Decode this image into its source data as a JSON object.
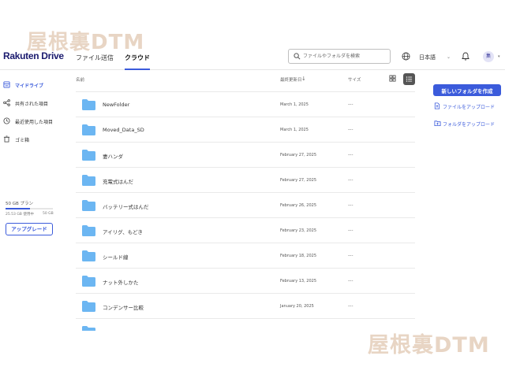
{
  "watermark": {
    "text": "屋根裏DTM"
  },
  "header": {
    "logo": "Rakuten Drive",
    "tabs": [
      {
        "label": "ファイル送信"
      },
      {
        "label": "クラウド"
      }
    ],
    "search_placeholder": "ファイルやフォルダを検索",
    "language": "日本語",
    "avatar_initial": "集"
  },
  "sidebar": {
    "items": [
      {
        "label": "マイドライブ",
        "icon": "my-drive-icon"
      },
      {
        "label": "共有された項目",
        "icon": "share-icon"
      },
      {
        "label": "最近使用した項目",
        "icon": "clock-icon"
      },
      {
        "label": "ゴミ箱",
        "icon": "trash-icon"
      }
    ],
    "storage": {
      "plan": "50 GB プラン",
      "used": "25.53 GB 使用中",
      "total": "50 GB",
      "used_fraction": 0.51
    },
    "upgrade_label": "アップグレード"
  },
  "table": {
    "columns": {
      "name": "名前",
      "date": "最終更新日",
      "size": "サイズ"
    },
    "rows": [
      {
        "name": "NewFolder",
        "date": "March 1, 2025",
        "size": "---"
      },
      {
        "name": "Moved_Data_SD",
        "date": "March 1, 2025",
        "size": "---"
      },
      {
        "name": "妻ハンダ",
        "date": "February 27, 2025",
        "size": "---"
      },
      {
        "name": "充電式はんだ",
        "date": "February 27, 2025",
        "size": "---"
      },
      {
        "name": "バッテリー式はんだ",
        "date": "February 26, 2025",
        "size": "---"
      },
      {
        "name": "アイリグ、もどき",
        "date": "February 23, 2025",
        "size": "---"
      },
      {
        "name": "シールド線",
        "date": "February 18, 2025",
        "size": "---"
      },
      {
        "name": "ナット外しかた",
        "date": "February 13, 2025",
        "size": "---"
      },
      {
        "name": "コンデンサー比較",
        "date": "January 20, 2025",
        "size": "---"
      }
    ]
  },
  "actions": {
    "new_folder": "新しいフォルダを作成",
    "upload_file": "ファイルをアップロード",
    "upload_folder": "フォルダをアップロード"
  },
  "colors": {
    "accent": "#3b5bdb",
    "folder": "#6cb6f2",
    "watermark": "#e8d5c4"
  }
}
